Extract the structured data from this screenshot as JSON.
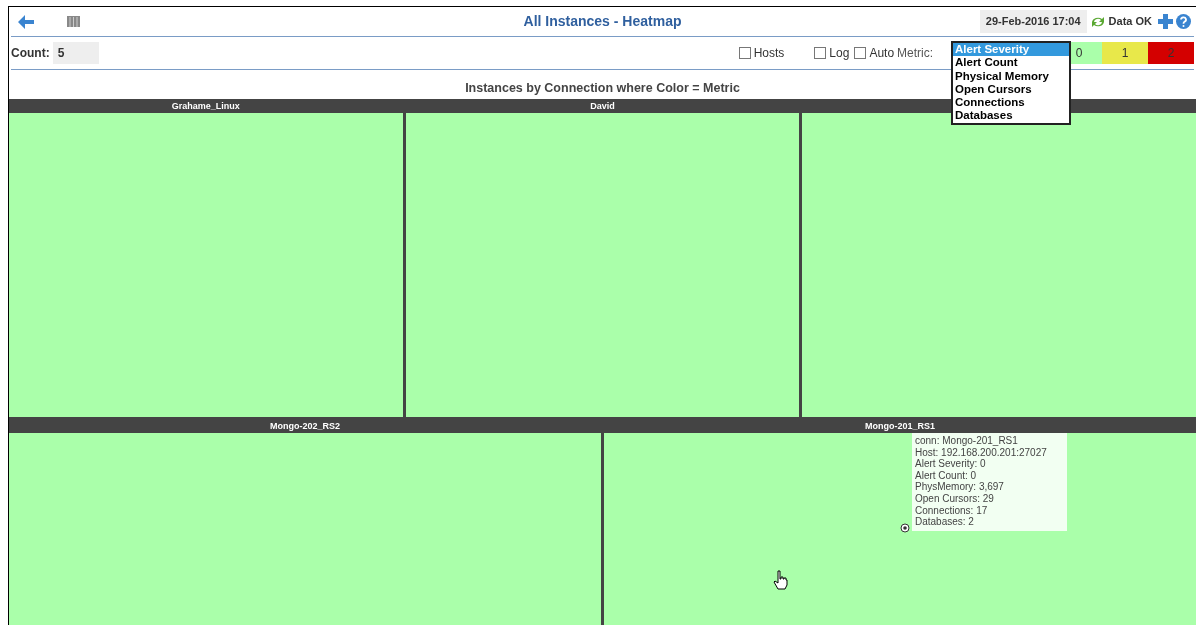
{
  "header": {
    "title": "All Instances - Heatmap",
    "timestamp": "29-Feb-2016 17:04",
    "data_status": "Data OK"
  },
  "toolbar": {
    "count_label": "Count:",
    "count_value": "5",
    "checkboxes": [
      {
        "label": "Hosts",
        "checked": false
      },
      {
        "label": "Log",
        "checked": false
      },
      {
        "label": "Auto",
        "checked": false
      }
    ],
    "metric_label": "Metric:",
    "metric_options": [
      {
        "label": "Alert Severity",
        "selected": true
      },
      {
        "label": "Alert Count",
        "selected": false
      },
      {
        "label": "Physical Memory",
        "selected": false
      },
      {
        "label": "Open Cursors",
        "selected": false
      },
      {
        "label": "Connections",
        "selected": false
      },
      {
        "label": "Databases",
        "selected": false
      }
    ],
    "legend": [
      {
        "label": "0",
        "color": "#aaffaa"
      },
      {
        "label": "1",
        "color": "#e8e84a"
      },
      {
        "label": "2",
        "color": "#d40000"
      }
    ]
  },
  "heatmap": {
    "title": "Instances by Connection where Color = Metric",
    "rows": [
      [
        {
          "name": "Grahame_Linux",
          "color": "#aaffaa"
        },
        {
          "name": "David",
          "color": "#aaffaa"
        },
        {
          "color": "#aaffaa"
        }
      ],
      [
        {
          "name": "Mongo-202_RS2",
          "color": "#aaffaa"
        },
        {
          "name": "Mongo-201_RS1",
          "color": "#aaffaa"
        }
      ]
    ]
  },
  "tooltip": {
    "lines": [
      "conn: Mongo-201_RS1",
      "Host: 192.168.200.201:27027",
      "Alert Severity: 0",
      "Alert Count: 0",
      "PhysMemory: 3,697",
      "Open Cursors: 29",
      "Connections: 17",
      "Databases: 2"
    ]
  }
}
